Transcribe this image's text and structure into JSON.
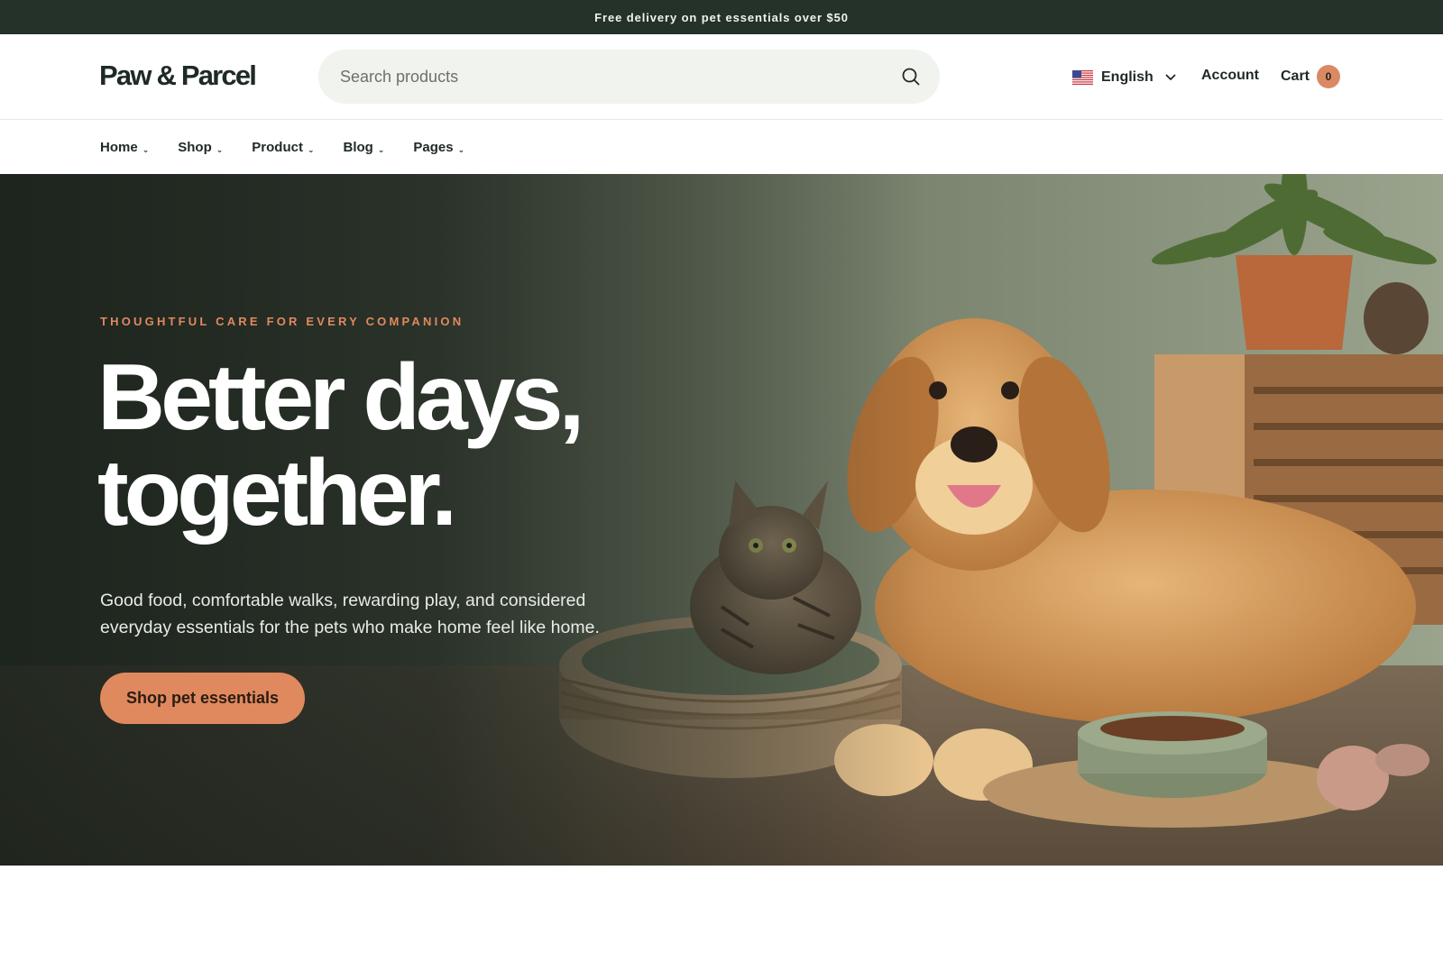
{
  "announcement": {
    "text": "Free delivery on pet essentials over $50"
  },
  "header": {
    "logo": "Paw & Parcel",
    "search": {
      "placeholder": "Search products",
      "value": ""
    },
    "language": {
      "label": "English",
      "flag": "us-flag-icon"
    },
    "account_label": "Account",
    "cart": {
      "label": "Cart",
      "count": "0"
    }
  },
  "nav": {
    "items": [
      {
        "label": "Home"
      },
      {
        "label": "Shop"
      },
      {
        "label": "Product"
      },
      {
        "label": "Blog"
      },
      {
        "label": "Pages"
      }
    ]
  },
  "hero": {
    "eyebrow": "THOUGHTFUL CARE FOR EVERY COMPANION",
    "headline_line1": "Better days,",
    "headline_line2": "together.",
    "subcopy_line1": "Good food, comfortable walks, rewarding play, and considered",
    "subcopy_line2": "everyday essentials for the pets who make home feel like home.",
    "cta_label": "Shop pet essentials"
  },
  "colors": {
    "announcement_bg": "#243229",
    "accent": "#e0895e",
    "text_dark": "#1f2a24",
    "search_bg": "#f1f3ef"
  }
}
